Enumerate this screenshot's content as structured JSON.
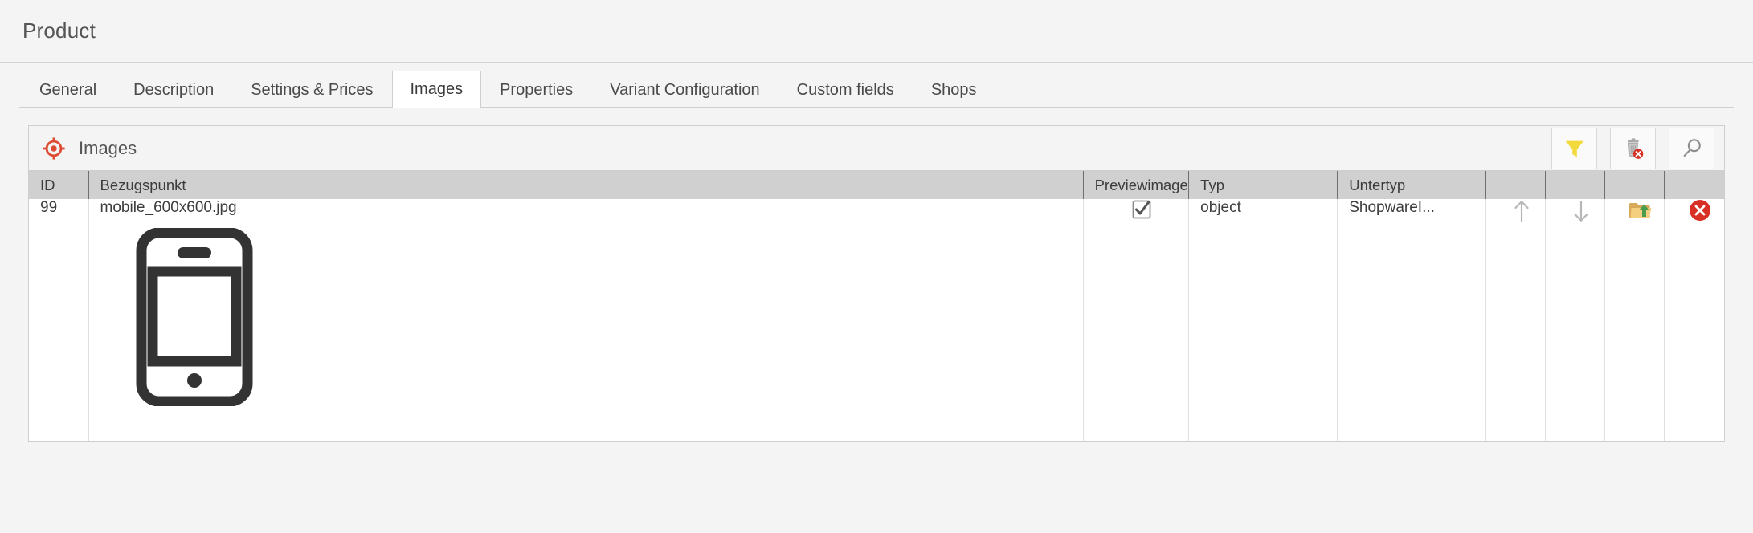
{
  "header": {
    "title": "Product"
  },
  "tabs": [
    {
      "label": "General",
      "active": false
    },
    {
      "label": "Description",
      "active": false
    },
    {
      "label": "Settings & Prices",
      "active": false
    },
    {
      "label": "Images",
      "active": true
    },
    {
      "label": "Properties",
      "active": false
    },
    {
      "label": "Variant Configuration",
      "active": false
    },
    {
      "label": "Custom fields",
      "active": false
    },
    {
      "label": "Shops",
      "active": false
    }
  ],
  "panel": {
    "title": "Images",
    "icon": "target-icon",
    "tools": [
      {
        "name": "filter-button",
        "icon": "filter-funnel-icon",
        "title": "Filter"
      },
      {
        "name": "delete-all-button",
        "icon": "trash-delete-icon",
        "title": "Delete"
      },
      {
        "name": "search-button",
        "icon": "magnifier-icon",
        "title": "Search"
      }
    ]
  },
  "grid": {
    "columns": [
      {
        "key": "id",
        "label": "ID"
      },
      {
        "key": "bezugspunkt",
        "label": "Bezugspunkt"
      },
      {
        "key": "previewimage",
        "label": "Previewimage"
      },
      {
        "key": "typ",
        "label": "Typ"
      },
      {
        "key": "untertyp",
        "label": "Untertyp"
      },
      {
        "key": "move_up",
        "label": ""
      },
      {
        "key": "move_down",
        "label": ""
      },
      {
        "key": "upload",
        "label": ""
      },
      {
        "key": "remove",
        "label": ""
      }
    ],
    "rows": [
      {
        "id": "99",
        "bezugspunkt": "mobile_600x600.jpg",
        "thumbnail": "smartphone-icon",
        "previewimage_checked": true,
        "typ": "object",
        "untertyp": "ShopwareI...",
        "actions": [
          {
            "name": "move-up-icon",
            "icon": "arrow-up-icon"
          },
          {
            "name": "move-down-icon",
            "icon": "arrow-down-icon"
          },
          {
            "name": "upload-icon",
            "icon": "folder-upload-icon"
          },
          {
            "name": "delete-row-icon",
            "icon": "red-x-circle-icon"
          }
        ]
      }
    ]
  },
  "colors": {
    "accent_red": "#dd4b33",
    "filter_yellow": "#f2d93c",
    "folder_tan": "#e8bd6b",
    "upload_green": "#4caf50",
    "page_bg": "#f4f4f4",
    "header_row_bg": "#d0d0d0"
  }
}
